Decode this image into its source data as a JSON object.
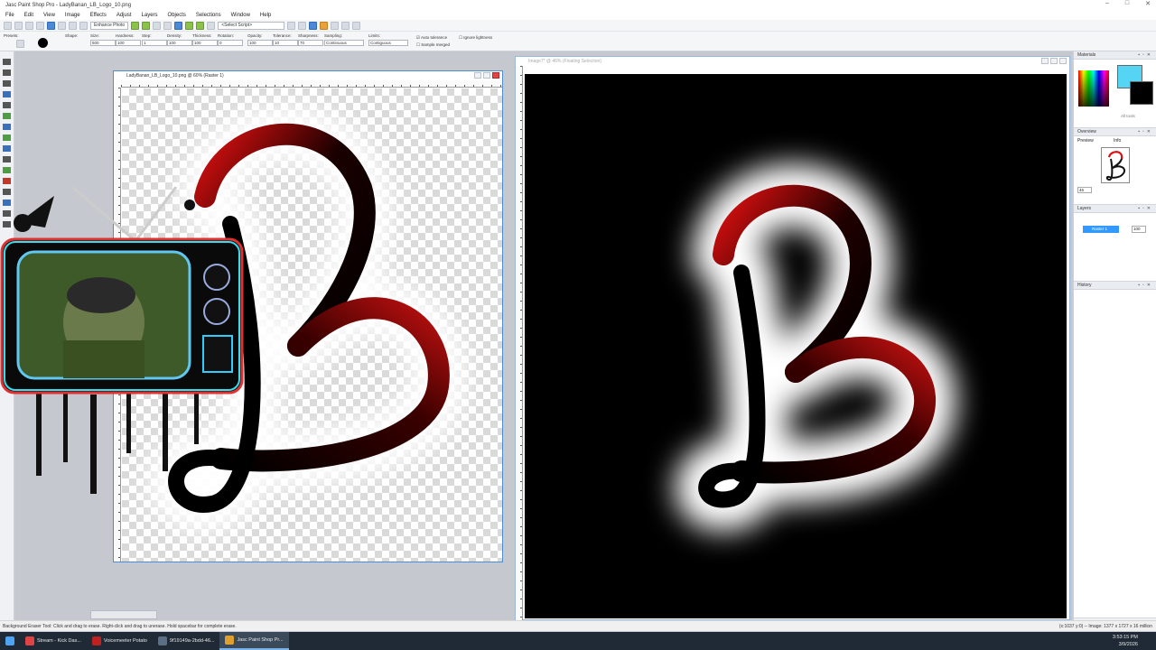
{
  "app": {
    "title": "Jasc Paint Shop Pro - LadyBanan_LB_Logo_10.png",
    "window_controls": [
      "–",
      "□",
      "✕"
    ]
  },
  "menu": [
    "File",
    "Edit",
    "View",
    "Image",
    "Effects",
    "Adjust",
    "Layers",
    "Objects",
    "Selections",
    "Window",
    "Help"
  ],
  "toolbar": {
    "enhance_photo": "Enhance Photo",
    "select_script": "<Select Script>"
  },
  "tool_options": {
    "presets": "Presets:",
    "shape": "Shape:",
    "size_label": "Size:",
    "size": "500",
    "hardness_label": "Hardness:",
    "hardness": "100",
    "step_label": "Step:",
    "step": "1",
    "density_label": "Density:",
    "density": "100",
    "thickness_label": "Thickness:",
    "thickness": "100",
    "rotation_label": "Rotation:",
    "rotation": "0",
    "opacity_label": "Opacity:",
    "opacity": "100",
    "tolerance_label": "Tolerance:",
    "tolerance": "10",
    "sharpness_label": "Sharpness:",
    "sharpness": "70",
    "sampling_label": "Sampling:",
    "sampling": "Continuous",
    "limits_label": "Limits:",
    "limits": "Contiguous",
    "auto_tolerance": "Auto tolerance",
    "sample_merged": "Sample merged",
    "ignore_lightness": "Ignore lightness"
  },
  "doc1": {
    "title": "LadyBanan_LB_Logo_10.png @ 60% (Raster 1)"
  },
  "doc2": {
    "title": "Image7* @ 46% (Floating Selection)"
  },
  "panels": {
    "materials": "Materials",
    "all_tools": "All tools",
    "overview": "Overview",
    "preview_tab": "Preview",
    "info_tab": "Info",
    "zoom": "46",
    "layers": "Layers",
    "layer_name": "Raster 1",
    "layer_opacity": "100",
    "history": "History"
  },
  "status": {
    "left": "Background Eraser Tool: Click and drag to erase. Right-click and drag to unerase. Hold spacebar for complete erase.",
    "right": "(x:1037 y:0) -- Image: 1377 x 1727 x 16 million"
  },
  "taskbar": {
    "items": [
      "Stream - Kick Das...",
      "Voicemeeter Potato",
      "9f19149a-2bdd-46...",
      "Jasc Paint Shop Pr..."
    ],
    "time": "3:53:15 PM",
    "date": "3/9/2026"
  },
  "colors": {
    "accent_blue": "#4d8ed1",
    "logo_red": "#e01010",
    "foreground_swatch": "#56d4f4",
    "layer_highlight": "#3399ff"
  }
}
